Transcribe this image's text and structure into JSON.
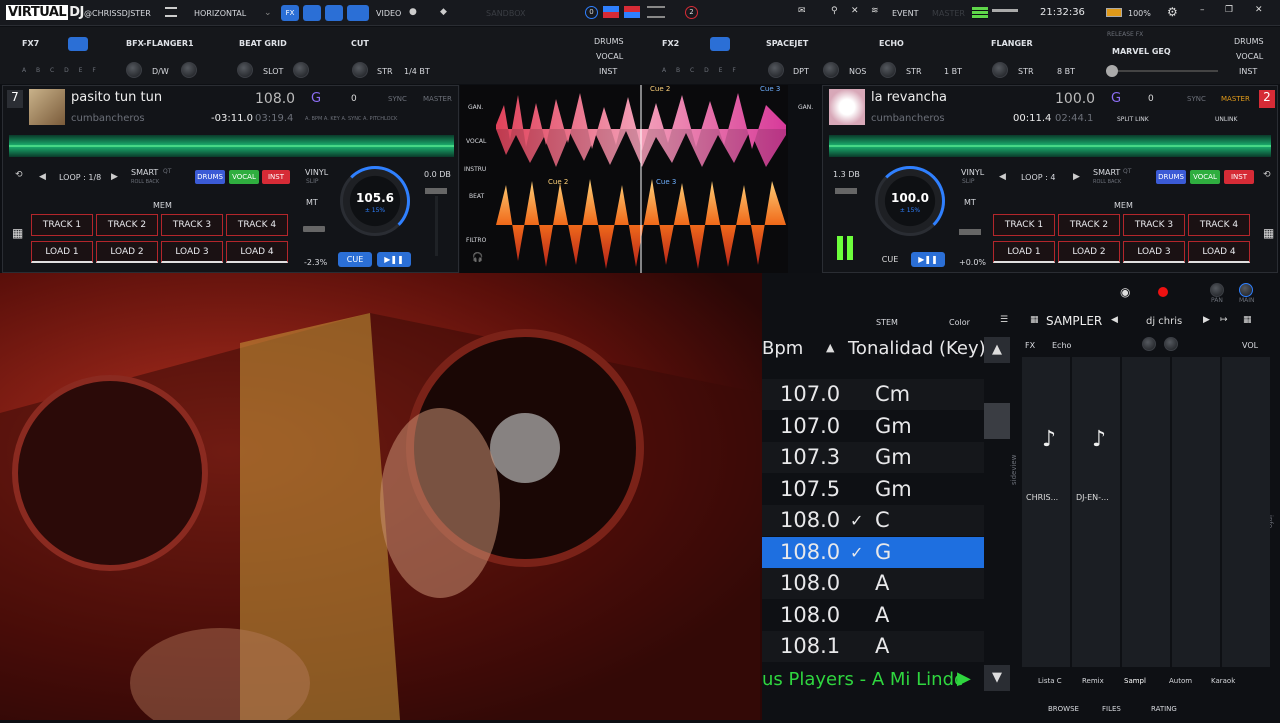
{
  "topbar": {
    "logo_v": "VIRTUAL",
    "logo_dj": "DJ",
    "user": "@CHRISSDJSTER",
    "layout": "HORIZONTAL",
    "fx": "FX",
    "video": "VIDEO",
    "sandbox": "SANDBOX",
    "event": "EVENT",
    "master": "MASTER",
    "time": "21:32:36",
    "battery": "100%",
    "num_left": "0",
    "num_right": "2"
  },
  "fx_left": {
    "slot": "FX7",
    "effect": "BFX-FLANGER1",
    "grid": "BEAT GRID",
    "cut": "CUT",
    "letters": "A B C D E F",
    "dw": "D/W",
    "slot_lbl": "SLOT",
    "str": "STR",
    "beat": "1/4 bt",
    "drums": "DRUMS",
    "vocal": "VOCAL",
    "inst": "INST"
  },
  "fx_right": {
    "slot": "FX2",
    "effect": "SPACEJET",
    "echo": "ECHO",
    "flanger": "FLANGER",
    "release": "RELEASE FX",
    "geq": "MARVEL GEQ",
    "dpt": "DPT",
    "nos": "NOS",
    "str": "STR",
    "beat1": "1 bt",
    "beat2": "8 bt",
    "letters": "A B C D E F",
    "drums": "DRUMS",
    "vocal": "VOCAL",
    "inst": "INST"
  },
  "deck1": {
    "num": "7",
    "title": "pasito tun tun",
    "artist": "cumbancheros",
    "bpm": "108.0",
    "key": "G",
    "pitch": "0",
    "sync": "SYNC",
    "master": "MASTER",
    "remain": "-03:11.0",
    "total": "03:19.4",
    "sub": "A. BPM   A. KEY   A. SYNC   A. PITCHLOCK",
    "loop": "LOOP : 1/8",
    "smart": "SMART",
    "roll": "ROLL BACK",
    "qt": "QT",
    "drums": "DRUMS",
    "vocal": "VOCAL",
    "inst": "INST",
    "mem": "MEM",
    "tracks": [
      "TRACK 1",
      "TRACK 2",
      "TRACK 3",
      "TRACK 4"
    ],
    "loads": [
      "LOAD 1",
      "LOAD 2",
      "LOAD 3",
      "LOAD 4"
    ],
    "jog_bpm": "105.6",
    "jog_pct": "± 15%",
    "vinyl": "VINYL",
    "slip": "SLIP",
    "mt": "MT",
    "pitchval": "-2.3%",
    "cue": "CUE",
    "play": "▶❚❚",
    "gain": "0.0 dB"
  },
  "deck2": {
    "num": "2",
    "title": "la revancha",
    "artist": "cumbancheros",
    "bpm": "100.0",
    "key": "G",
    "pitch": "0",
    "sync": "SYNC",
    "master": "MASTER",
    "elapsed": "00:11.4",
    "total": "02:44.1",
    "split": "SPLIT LINK",
    "unlink": "UNLINK",
    "loop": "LOOP : 4",
    "smart": "SMART",
    "roll": "ROLL BACK",
    "qt": "QT",
    "drums": "DRUMS",
    "vocal": "VOCAL",
    "inst": "INST",
    "mem": "MEM",
    "tracks": [
      "TRACK 1",
      "TRACK 2",
      "TRACK 3",
      "TRACK 4"
    ],
    "loads": [
      "LOAD 1",
      "LOAD 2",
      "LOAD 3",
      "LOAD 4"
    ],
    "jog_bpm": "100.0",
    "jog_pct": "± 15%",
    "vinyl": "VINYL",
    "slip": "SLIP",
    "mt": "MT",
    "pitchval": "+0.0%",
    "cue": "CUE",
    "play": "▶❚❚",
    "gain": "1.3 dB"
  },
  "mixer": {
    "labels": [
      "GAN.",
      "VOCAL",
      "INSTRU",
      "BEAT",
      "FILTRO"
    ],
    "cue2": "Cue 2",
    "cue3": "Cue 3"
  },
  "browser": {
    "stem": "STEM",
    "color": "Color",
    "sampler": "SAMPLER",
    "dj": "dj chris",
    "fx": "FX",
    "fx_val": "Echo",
    "vol": "VOL",
    "pan": "PAN",
    "main": "MAIN",
    "col_bpm": "Bpm",
    "col_key": "Tonalidad (Key)",
    "sideview": "sideview",
    "info": "info",
    "rows": [
      {
        "bpm": "107.0",
        "key": "Cm",
        "check": false
      },
      {
        "bpm": "107.0",
        "key": "Gm",
        "check": false
      },
      {
        "bpm": "107.3",
        "key": "Gm",
        "check": false
      },
      {
        "bpm": "107.5",
        "key": "Gm",
        "check": false
      },
      {
        "bpm": "108.0",
        "key": "C",
        "check": true
      },
      {
        "bpm": "108.0",
        "key": "G",
        "check": true
      },
      {
        "bpm": "108.0",
        "key": "A",
        "check": false
      },
      {
        "bpm": "108.0",
        "key": "A",
        "check": false
      },
      {
        "bpm": "108.1",
        "key": "A",
        "check": false
      }
    ],
    "ticker": "us Players - A Mi Lindo E",
    "samples": [
      "CHRIS...",
      "DJ-EN-..."
    ],
    "tabs": [
      "Lista C",
      "Remix",
      "Sampl",
      "Autom",
      "Karaok"
    ],
    "bottom": [
      "BROWSE",
      "FILES",
      "RATING"
    ]
  },
  "colors": {
    "accent": "#2f80ff",
    "pad_red": "#b3262b",
    "wave_green": "#1aa86a",
    "highlight": "#1e6fe0"
  }
}
